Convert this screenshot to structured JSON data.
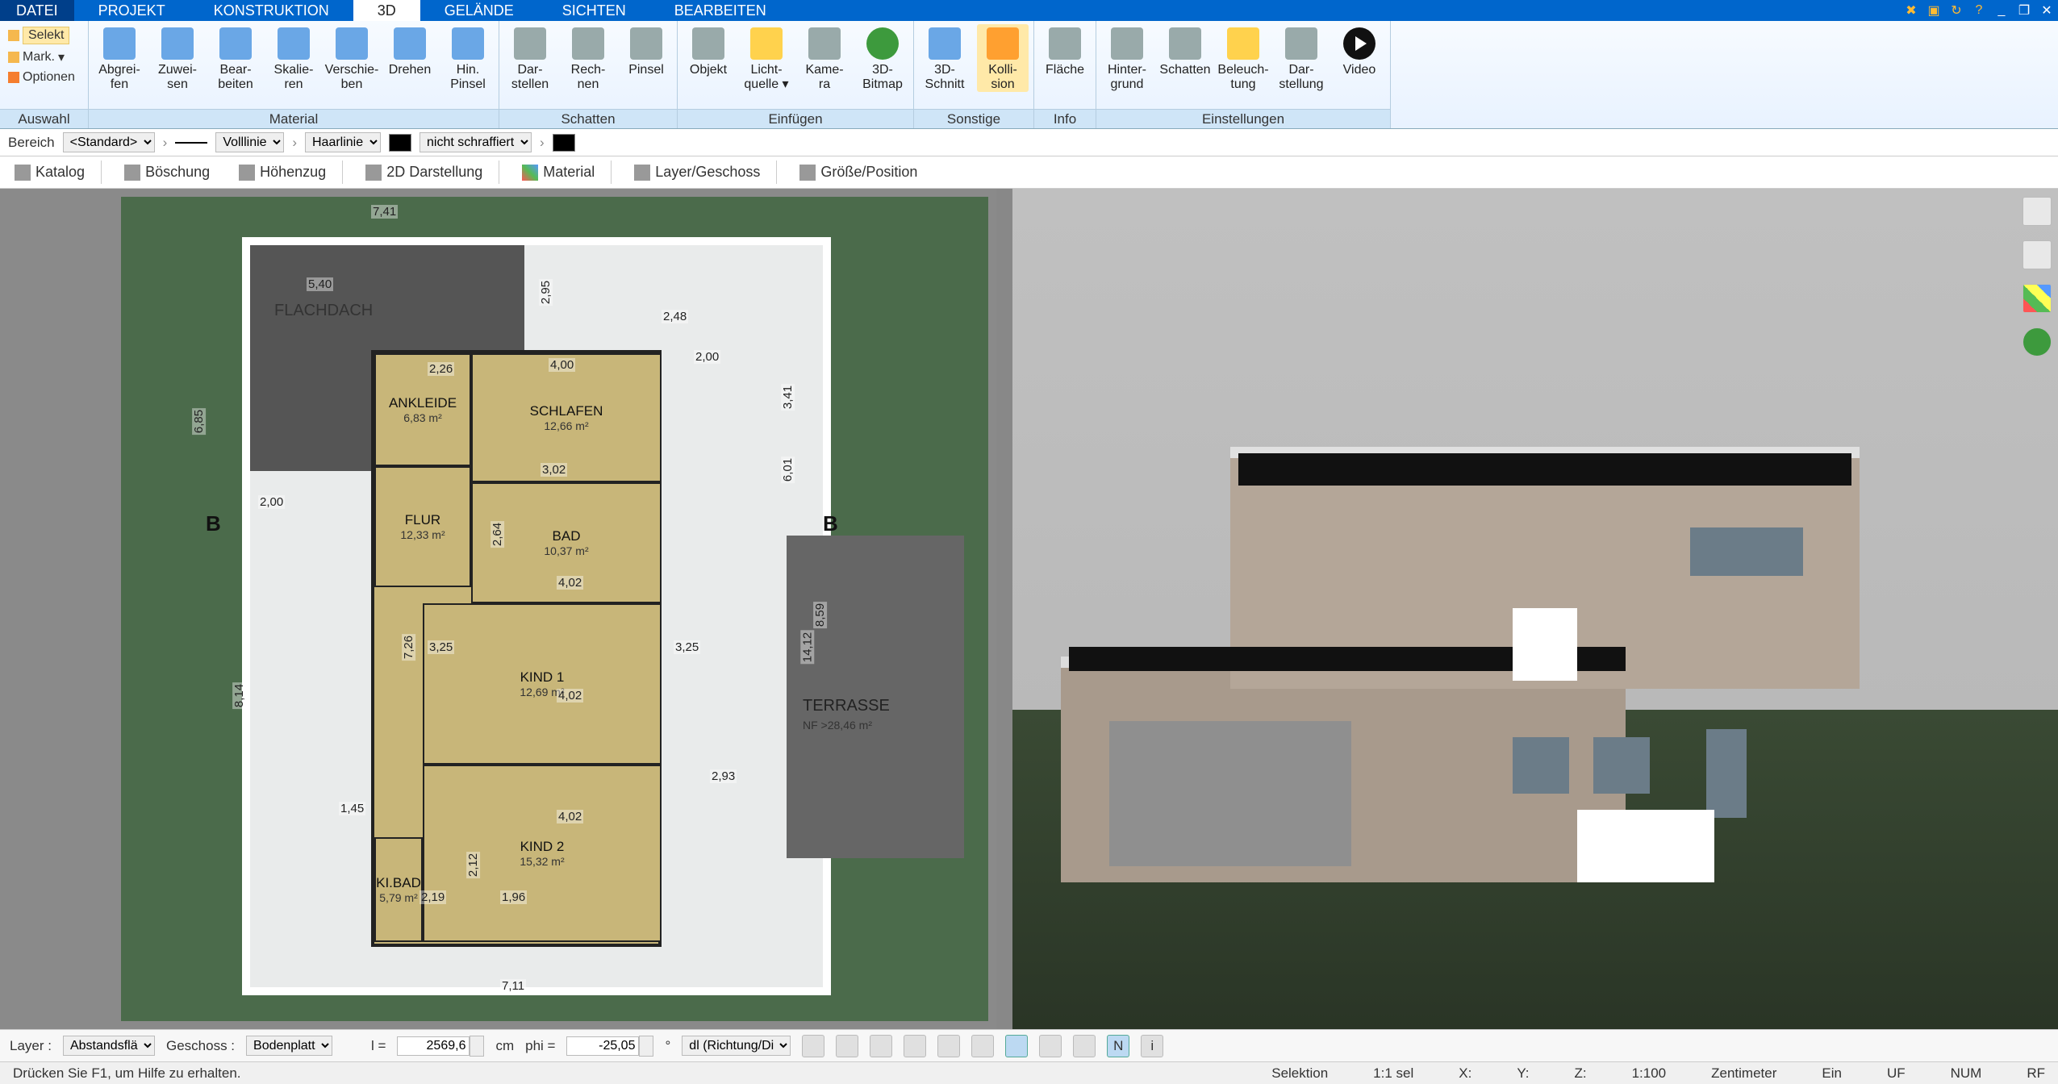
{
  "menu": {
    "tabs": [
      "DATEI",
      "PROJEKT",
      "KONSTRUKTION",
      "3D",
      "GELÄNDE",
      "SICHTEN",
      "BEARBEITEN"
    ],
    "active_index": 3
  },
  "ribbon": {
    "groups": {
      "auswahl": {
        "title": "Auswahl",
        "items": [
          "Selekt",
          "Mark.",
          "Optionen"
        ]
      },
      "material": {
        "title": "Material",
        "btns": [
          {
            "l1": "Abgrei-",
            "l2": "fen"
          },
          {
            "l1": "Zuwei-",
            "l2": "sen"
          },
          {
            "l1": "Bear-",
            "l2": "beiten"
          },
          {
            "l1": "Skalie-",
            "l2": "ren"
          },
          {
            "l1": "Verschie-",
            "l2": "ben"
          },
          {
            "l1": "Drehen",
            "l2": ""
          },
          {
            "l1": "Hin.",
            "l2": "Pinsel"
          }
        ]
      },
      "schatten": {
        "title": "Schatten",
        "btns": [
          {
            "l1": "Dar-",
            "l2": "stellen"
          },
          {
            "l1": "Rech-",
            "l2": "nen"
          },
          {
            "l1": "Pinsel",
            "l2": ""
          }
        ]
      },
      "einfuegen": {
        "title": "Einfügen",
        "btns": [
          {
            "l1": "Objekt",
            "l2": ""
          },
          {
            "l1": "Licht-",
            "l2": "quelle ▾"
          },
          {
            "l1": "Kame-",
            "l2": "ra"
          },
          {
            "l1": "3D-",
            "l2": "Bitmap"
          }
        ]
      },
      "sonstige": {
        "title": "Sonstige",
        "btns": [
          {
            "l1": "3D-",
            "l2": "Schnitt"
          },
          {
            "l1": "Kolli-",
            "l2": "sion"
          }
        ]
      },
      "info": {
        "title": "Info",
        "btns": [
          {
            "l1": "Fläche",
            "l2": ""
          }
        ]
      },
      "einstellungen": {
        "title": "Einstellungen",
        "btns": [
          {
            "l1": "Hinter-",
            "l2": "grund"
          },
          {
            "l1": "Schatten",
            "l2": ""
          },
          {
            "l1": "Beleuch-",
            "l2": "tung"
          },
          {
            "l1": "Dar-",
            "l2": "stellung"
          },
          {
            "l1": "Video",
            "l2": ""
          }
        ]
      }
    }
  },
  "optbar": {
    "bereich_label": "Bereich",
    "bereich_value": "<Standard>",
    "line_style": "Volllinie",
    "haarlinie": "Haarlinie",
    "hatch": "nicht schraffiert"
  },
  "tooltabs": [
    "Katalog",
    "Böschung",
    "Höhenzug",
    "2D Darstellung",
    "Material",
    "Layer/Geschoss",
    "Größe/Position"
  ],
  "floorplan": {
    "rooms": {
      "flachdach": "FLACHDACH",
      "ankleide": {
        "name": "ANKLEIDE",
        "area": "6,83 m²"
      },
      "schlafen": {
        "name": "SCHLAFEN",
        "area": "12,66 m²"
      },
      "flur": {
        "name": "FLUR",
        "area": "12,33 m²"
      },
      "bad": {
        "name": "BAD",
        "area": "10,37 m²"
      },
      "kind1": {
        "name": "KIND 1",
        "area": "12,69 m²"
      },
      "kind2": {
        "name": "KIND 2",
        "area": "15,32 m²"
      },
      "kibad": {
        "name": "KI.BAD",
        "area": "5,79 m²"
      },
      "terrasse": {
        "name": "TERRASSE",
        "area": "NF >28,46 m²"
      }
    },
    "dims": {
      "d1": "7,41",
      "d2": "2,48",
      "d3": "2,00",
      "d4": "4,00",
      "d5": "3,02",
      "d6": "4,02",
      "d7": "3,25",
      "d8": "2,26",
      "d9": "2,64",
      "d10": "1,45",
      "d11": "2,12",
      "d12": "2,93",
      "d13": "6,01",
      "d14": "3,41",
      "d15": "8,14",
      "d16": "6,85",
      "d17": "8,59",
      "d18": "14,12",
      "d19": "7,11",
      "d20": "2,95",
      "d21": "7,26",
      "d22": "2,19",
      "d23": "1,96",
      "d24": "5,40",
      "d25": "2,00"
    },
    "section": "B"
  },
  "bottombar": {
    "layer_label": "Layer :",
    "layer_value": "Abstandsflä",
    "geschoss_label": "Geschoss :",
    "geschoss_value": "Bodenplatt",
    "l_label": "l =",
    "l_value": "2569,6",
    "l_unit": "cm",
    "phi_label": "phi =",
    "phi_value": "-25,05",
    "phi_unit": "°",
    "dl_value": "dl (Richtung/Di"
  },
  "status": {
    "help": "Drücken Sie F1, um Hilfe zu erhalten.",
    "selektion": "Selektion",
    "sel": "1:1 sel",
    "x": "X:",
    "y": "Y:",
    "z": "Z:",
    "scale": "1:100",
    "unit": "Zentimeter",
    "ein": "Ein",
    "uf": "UF",
    "num": "NUM",
    "rf": "RF"
  }
}
